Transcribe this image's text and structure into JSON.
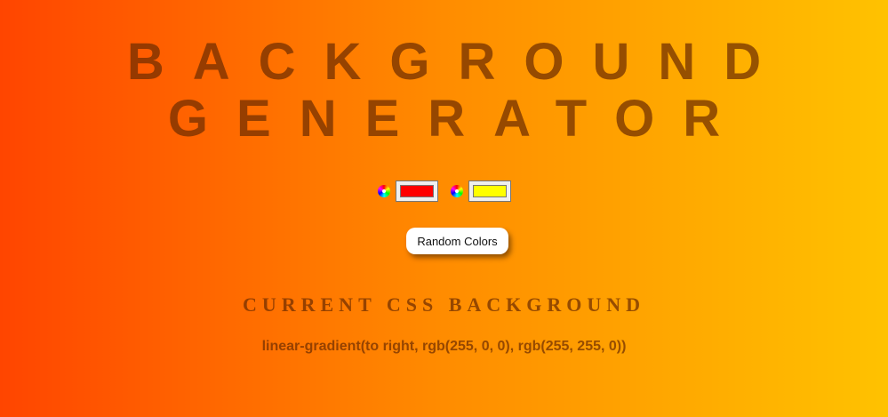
{
  "title": {
    "line1": "BACKGROUND",
    "line2": "GENERATOR"
  },
  "pickers": [
    {
      "icon": "color-wheel-icon",
      "value": "#ff0000"
    },
    {
      "icon": "color-wheel-icon",
      "value": "#ffff00"
    }
  ],
  "random_button_label": "Random Colors",
  "subtitle": "CURRENT CSS BACKGROUND",
  "css_output": "linear-gradient(to right, rgb(255, 0, 0), rgb(255, 255, 0))",
  "colors": {
    "gradient_start": "#ff4500",
    "gradient_end": "#ffc200",
    "text": "#6e2d00"
  }
}
